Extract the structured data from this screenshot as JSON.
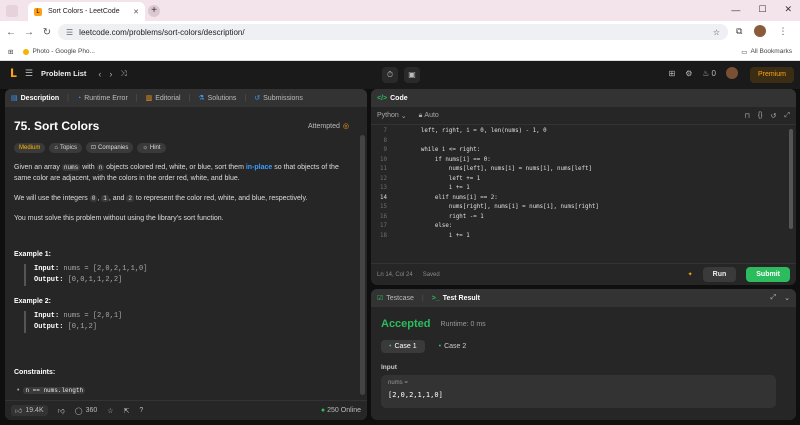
{
  "browser": {
    "tab_title": "Sort Colors - LeetCode",
    "url": "leetcode.com/problems/sort-colors/description/",
    "bookmark": "Photo - Google Pho...",
    "all_bookmarks": "All Bookmarks"
  },
  "header": {
    "problem_list": "Problem List",
    "fire_count": "0",
    "premium": "Premium"
  },
  "left_tabs": [
    "Description",
    "Runtime Error",
    "Editorial",
    "Solutions",
    "Submissions"
  ],
  "problem": {
    "title": "75. Sort Colors",
    "status": "Attempted",
    "difficulty": "Medium",
    "chips": [
      "Topics",
      "Companies",
      "Hint"
    ],
    "p1_a": "Given an array ",
    "p1_code": "nums",
    "p1_b": " with ",
    "p1_code2": "n",
    "p1_c": " objects colored red, white, or blue, sort them ",
    "p1_link": "in-place",
    "p1_d": " so that objects of the same color are adjacent, with the colors in the order red, white, and blue.",
    "p2_a": "We will use the integers ",
    "p2_0": "0",
    "p2_b": ", ",
    "p2_1": "1",
    "p2_c": ", and ",
    "p2_2": "2",
    "p2_d": " to represent the color red, white, and blue, respectively.",
    "p3": "You must solve this problem without using the library's sort function.",
    "ex1_title": "Example 1:",
    "ex1_input_label": "Input:",
    "ex1_input": " nums = [2,0,2,1,1,0]",
    "ex1_output_label": "Output:",
    "ex1_output": " [0,0,1,1,2,2]",
    "ex2_title": "Example 2:",
    "ex2_input_label": "Input:",
    "ex2_input": " nums = [2,0,1]",
    "ex2_output_label": "Output:",
    "ex2_output": " [0,1,2]",
    "constraints": "Constraints:",
    "constraint1": "n == nums.length"
  },
  "footer_left": {
    "likes": "19.4K",
    "comments": "360",
    "online": "250 Online"
  },
  "code": {
    "title": "Code",
    "language": "Python",
    "mode": "Auto",
    "lines": [
      {
        "n": "7",
        "t": "        left, right, i = 0, len(nums) - 1, 0"
      },
      {
        "n": "8",
        "t": ""
      },
      {
        "n": "9",
        "t": "        while i <= right:"
      },
      {
        "n": "10",
        "t": "            if nums[i] == 0:"
      },
      {
        "n": "11",
        "t": "                nums[left], nums[i] = nums[i], nums[left]"
      },
      {
        "n": "12",
        "t": "                left += 1"
      },
      {
        "n": "13",
        "t": "                i += 1"
      },
      {
        "n": "14",
        "t": "            elif nums[i] == 2:"
      },
      {
        "n": "15",
        "t": "                nums[right], nums[i] = nums[i], nums[right]"
      },
      {
        "n": "16",
        "t": "                right -= 1"
      },
      {
        "n": "17",
        "t": "            else:"
      },
      {
        "n": "18",
        "t": "                i += 1"
      }
    ],
    "cursor": "Ln 14, Col 24",
    "saved": "Saved",
    "run": "Run",
    "submit": "Submit"
  },
  "result": {
    "tab_testcase": "Testcase",
    "tab_result": "Test Result",
    "status": "Accepted",
    "runtime": "Runtime: 0 ms",
    "case1": "Case 1",
    "case2": "Case 2",
    "input_label": "Input",
    "var_label": "nums =",
    "var_value": "[2,0,2,1,1,0]"
  },
  "colors": {
    "accent": "#ffa116",
    "green": "#2cbb5d",
    "link": "#3b9cff"
  }
}
